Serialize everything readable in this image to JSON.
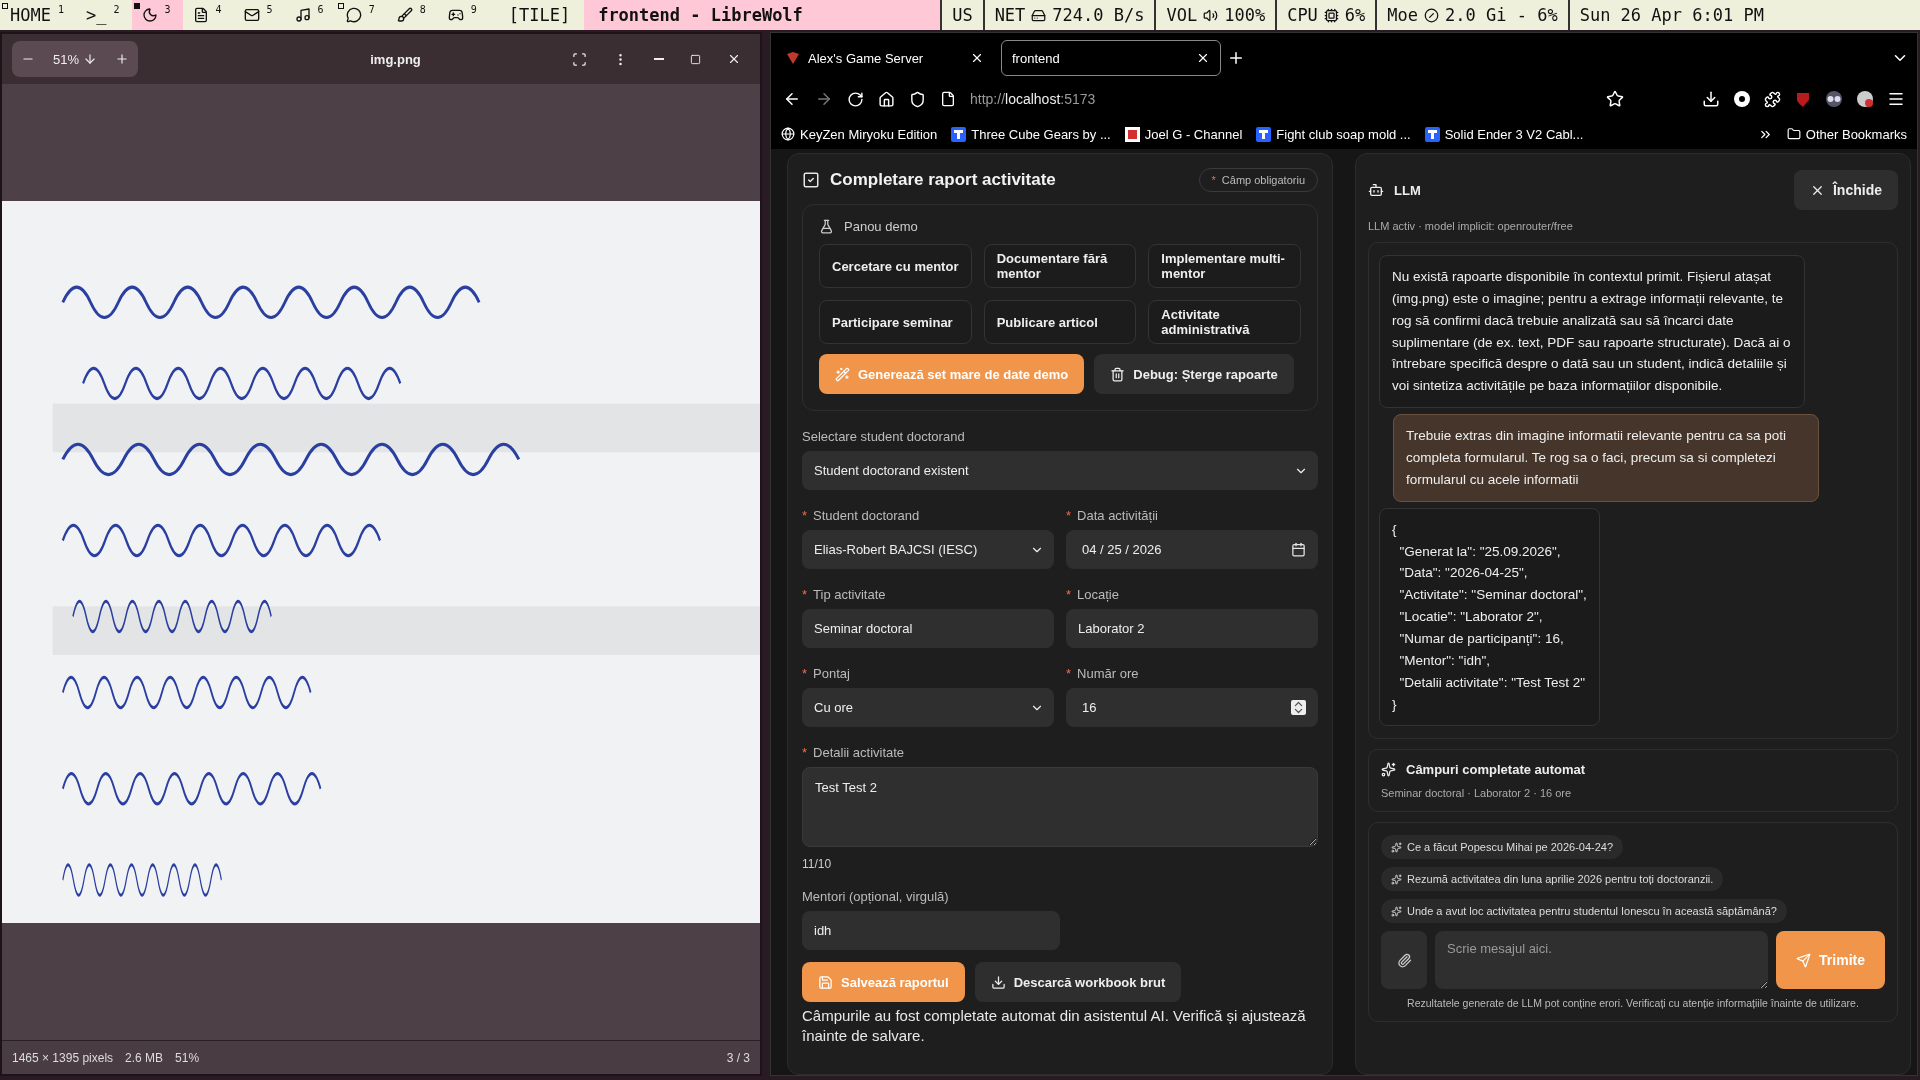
{
  "top_bar": {
    "workspaces": [
      {
        "label": "HOME",
        "number": "1",
        "occupied": true,
        "selected": false
      },
      {
        "label": ">_",
        "number": "2",
        "occupied": false,
        "selected": false
      },
      {
        "number": "3",
        "occupied": true,
        "selected": true
      },
      {
        "number": "4",
        "occupied": false,
        "selected": false
      },
      {
        "number": "5",
        "occupied": false,
        "selected": false
      },
      {
        "number": "6",
        "occupied": false,
        "selected": false
      },
      {
        "number": "7",
        "occupied": true,
        "selected": false
      },
      {
        "number": "8",
        "occupied": false,
        "selected": false
      },
      {
        "number": "9",
        "occupied": false,
        "selected": false
      }
    ],
    "layout": "[TILE]",
    "window_title": "frontend - LibreWolf",
    "status": [
      {
        "label": "US"
      },
      {
        "label": "NET",
        "value": "724.0 B/s"
      },
      {
        "label": "VOL",
        "value": "100%"
      },
      {
        "label": "CPU",
        "value": "6%"
      },
      {
        "label": "Moe",
        "value": "2.0 Gi - 6%"
      },
      {
        "label": "Sun 26 Apr 6:01 PM"
      }
    ]
  },
  "viewer": {
    "zoom": "51%",
    "title": "img.png",
    "status": [
      "1465 × 1395 pixels",
      "2.6 MB",
      "51%"
    ],
    "page": "3 / 3"
  },
  "browser": {
    "tabs": [
      {
        "title": "Alex's Game Server",
        "selected": false
      },
      {
        "title": "frontend",
        "selected": true
      }
    ],
    "url": {
      "scheme": "http://",
      "host": "localhost",
      "port": ":5173"
    },
    "bookmarks": [
      "KeyZen Miryoku Edition",
      "Three Cube Gears by ...",
      "Joel G - Channel",
      "Fight club soap mold ...",
      "Solid Ender 3 V2 Cabl..."
    ],
    "other_bookmarks": "Other Bookmarks"
  },
  "form": {
    "title": "Completare raport activitate",
    "required_mark": "*",
    "required_note": "Câmp obligatoriu",
    "demo": {
      "title": "Panou demo",
      "presets": [
        "Cercetare cu mentor",
        "Documentare fără mentor",
        "Implementare multi-mentor",
        "Participare seminar",
        "Publicare articol",
        "Activitate administrativă"
      ],
      "generate": "Generează set mare de date demo",
      "debug": "Debug: Șterge rapoarte"
    },
    "student_mode": {
      "label": "Selectare student doctorand",
      "value": "Student doctorand existent"
    },
    "fields": [
      {
        "kind": "select",
        "label": "Student doctorand",
        "value": "Elias-Robert BAJCSI (IESC)",
        "required": true
      },
      {
        "kind": "date",
        "label": "Data activității",
        "value": "04 / 25 / 2026",
        "required": true
      },
      {
        "kind": "text",
        "label": "Tip activitate",
        "value": "Seminar doctoral",
        "required": true
      },
      {
        "kind": "text",
        "label": "Locație",
        "value": "Laborator 2",
        "required": true
      },
      {
        "kind": "select",
        "label": "Pontaj",
        "value": "Cu ore",
        "required": true
      },
      {
        "kind": "number",
        "label": "Număr ore",
        "value": "16",
        "required": true
      }
    ],
    "details": {
      "label": "Detalii activitate",
      "value": "Test Test 2",
      "required": true,
      "counter": "11/10"
    },
    "mentors": {
      "label": "Mentori (opțional, virgulă)",
      "value": "idh",
      "required": false
    },
    "save": "Salvează raportul",
    "download": "Descarcă workbook brut",
    "note": "Câmpurile au fost completate automat din asistentul AI. Verifică și ajustează înainte de salvare."
  },
  "llm": {
    "title": "LLM",
    "close": "Închide",
    "status": "LLM activ · model implicit: openrouter/free",
    "messages": [
      {
        "kind": "assistant",
        "text": "Nu există rapoarte disponibile în contextul primit. Fișierul atașat (img.png) este o imagine; pentru a extrage informații relevante, te rog să confirmi dacă trebuie analizată sau să încarci date suplimentare (de ex. text, PDF sau rapoarte structurate). Dacă ai o întrebare specifică despre o dată sau un student, indică detaliile și voi sintetiza activitățile pe baza informațiilor disponibile."
      },
      {
        "kind": "user",
        "text": "Trebuie extras din imagine informatii relevante pentru ca sa poti completa formularul. Te rog sa o faci, precum sa si completezi formularul cu acele informatii"
      },
      {
        "kind": "assistant",
        "text": "{\n  \"Generat la\": \"25.09.2026\",\n  \"Data\": \"2026-04-25\",\n  \"Activitate\": \"Seminar doctoral\",\n  \"Locatie\": \"Laborator 2\",\n  \"Numar de participanți\": 16,\n  \"Mentor\": \"idh\",\n  \"Detalii activitate\": \"Test Test 2\"\n}"
      }
    ],
    "autofill": {
      "title": "Câmpuri completate automat",
      "summary": "Seminar doctoral · Laborator 2 · 16 ore"
    },
    "suggestions": [
      "Ce a făcut Popescu Mihai pe 2026-04-24?",
      "Rezumă activitatea din luna aprilie 2026 pentru toți doctoranzii.",
      "Unde a avut loc activitatea pentru studentul Ionescu în această săptămână?"
    ],
    "input": {
      "placeholder": "Scrie mesajul aici."
    },
    "send": "Trimite",
    "disclaimer": "Rezultatele generate de LLM pot conține erori. Verificați cu atenție informațiile înainte de utilizare."
  }
}
